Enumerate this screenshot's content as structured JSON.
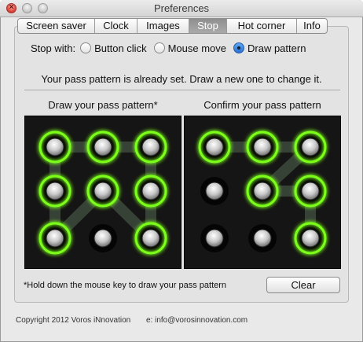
{
  "window": {
    "title": "Preferences"
  },
  "tabs": [
    {
      "label": "Screen saver",
      "active": false
    },
    {
      "label": "Clock",
      "active": false
    },
    {
      "label": "Images",
      "active": false
    },
    {
      "label": "Stop",
      "active": true
    },
    {
      "label": "Hot corner",
      "active": false
    },
    {
      "label": "Info",
      "active": false
    }
  ],
  "stop_with": {
    "label": "Stop with:",
    "options": [
      {
        "label": "Button click",
        "checked": false
      },
      {
        "label": "Mouse move",
        "checked": false
      },
      {
        "label": "Draw pattern",
        "checked": true
      }
    ]
  },
  "status_text": "Your pass pattern is already set. Draw a new one to change it.",
  "pads": {
    "draw": {
      "title": "Draw your pass pattern*",
      "active_nodes": [
        0,
        1,
        2,
        3,
        4,
        5,
        6,
        8
      ],
      "path": [
        [
          0,
          1
        ],
        [
          1,
          2
        ],
        [
          2,
          5
        ],
        [
          5,
          8
        ],
        [
          8,
          4
        ],
        [
          4,
          6
        ],
        [
          6,
          3
        ],
        [
          3,
          0
        ]
      ]
    },
    "confirm": {
      "title": "Confirm your pass pattern",
      "active_nodes": [
        0,
        1,
        2,
        4,
        5,
        8
      ],
      "path": [
        [
          0,
          1
        ],
        [
          1,
          2
        ],
        [
          2,
          4
        ],
        [
          4,
          5
        ],
        [
          5,
          8
        ]
      ]
    }
  },
  "footnote": "*Hold down the mouse key to draw your pass pattern",
  "clear_label": "Clear",
  "footer": {
    "copyright": "Copyright 2012 Voros iNnovation",
    "email": "e: info@vorosinnovation.com"
  },
  "colors": {
    "glow": "#7cff1a",
    "pad_bg": "#151515",
    "tab_active": "#9a9a9a"
  },
  "icons": {
    "close": "close-icon",
    "minimize": "minimize-icon",
    "maximize": "maximize-icon"
  }
}
